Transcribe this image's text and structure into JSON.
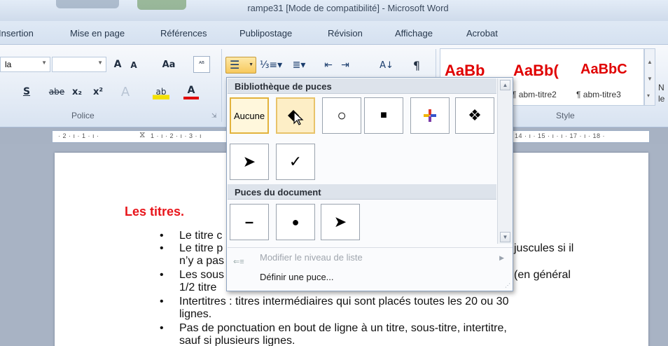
{
  "window": {
    "title": "rampe31 [Mode de compatibilité] - Microsoft Word"
  },
  "tabs": [
    "Insertion",
    "Mise en page",
    "Références",
    "Publipostage",
    "Révision",
    "Affichage",
    "Acrobat"
  ],
  "ribbon": {
    "font_name_value": "",
    "font_name_partial": "la",
    "font_group_label": "Police",
    "style_group_label": "Style",
    "style_samples": [
      "AaBb",
      "AaBb(",
      "AaBbC"
    ],
    "style_names": [
      "¶ abm-titre2",
      "¶ abm-titre3"
    ],
    "style_side_partial": [
      "N",
      "le"
    ],
    "buttons": {
      "grow_font": "A",
      "shrink_font": "A",
      "change_case": "Aa",
      "strike": "abe",
      "subscript": "x₂",
      "superscript": "x²",
      "underline": "S",
      "font_color": "A",
      "highlight": "ab",
      "sort": "A↓",
      "pilcrow": "¶"
    }
  },
  "ruler": {
    "text_left": "· 2 · ı · 1 · ı ·",
    "text_mid": "1 · ı · 2 · ı · 3 · ı",
    "text_right": "14 · ı · 15 · ı ·  ı · 17 · ı · 18 ·"
  },
  "document": {
    "heading": "Les titres.",
    "bullets": [
      {
        "line1": "Le titre c",
        "line2": ""
      },
      {
        "line1": "Le titre p",
        "tail": "juscules si il",
        "line2": "n’y a pas"
      },
      {
        "line1": "Les sous",
        "tail": "(en général",
        "line2": "1/2 titre"
      },
      {
        "line1": "Intertitres : titres intermédiaires qui sont placés toutes les 20 ou 30",
        "line2": "lignes."
      },
      {
        "line1": "Pas de ponctuation en bout de ligne à un titre, sous-titre, intertitre,",
        "line2": "sauf si plusieurs lignes."
      }
    ]
  },
  "bullet_dropdown": {
    "library_header": "Bibliothèque de puces",
    "document_header": "Puces du document",
    "library": [
      {
        "label": "Aucune",
        "icon": "none"
      },
      {
        "label": "",
        "icon": "diamond-arrow-icon"
      },
      {
        "label": "○",
        "icon": "circle-outline-icon"
      },
      {
        "label": "■",
        "icon": "square-icon"
      },
      {
        "label": "",
        "icon": "color-cross-icon"
      },
      {
        "label": "❖",
        "icon": "four-diamonds-icon"
      },
      {
        "label": "➤",
        "icon": "arrowhead-icon"
      },
      {
        "label": "✓",
        "icon": "checkmark-icon"
      }
    ],
    "document_bullets": [
      {
        "label": "–",
        "icon": "dash-icon"
      },
      {
        "label": "●",
        "icon": "dot-icon"
      },
      {
        "label": "➤",
        "icon": "arrowhead-icon"
      }
    ],
    "menu": [
      {
        "label": "Modifier le niveau de liste",
        "underline": "M",
        "enabled": false
      },
      {
        "label": "Définir une puce...",
        "underline": "D",
        "enabled": true
      }
    ]
  },
  "colors": {
    "accent_red": "#e8151b",
    "selection": "#e2b23c"
  }
}
